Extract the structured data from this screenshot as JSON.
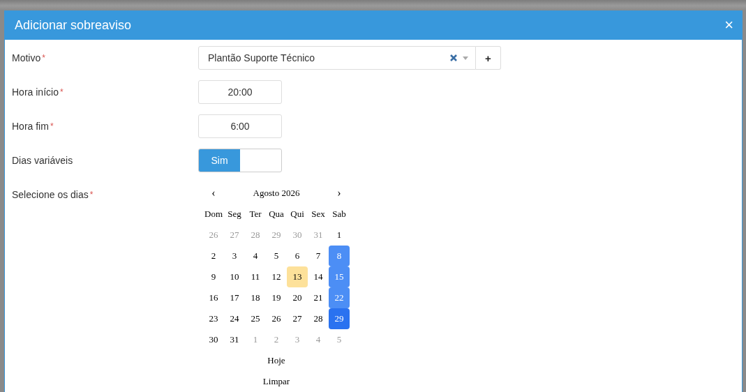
{
  "dialog": {
    "title": "Adicionar sobreaviso",
    "close": "×"
  },
  "fields": [
    {
      "kind": "select",
      "label": "Motivo",
      "required_mark": "*",
      "value": "Plantão Suporte Técnico",
      "add": "+"
    },
    {
      "kind": "time",
      "label": "Hora início",
      "required_mark": "*",
      "value": "20:00"
    },
    {
      "kind": "time",
      "label": "Hora fim",
      "required_mark": "*",
      "value": "6:00"
    },
    {
      "kind": "toggle",
      "label": "Dias variáveis",
      "value": "Sim",
      "on": true
    },
    {
      "kind": "calendar",
      "label": "Selecione os dias",
      "required_mark": "*"
    }
  ],
  "calendar": {
    "prev": "‹",
    "next": "›",
    "title": "Agosto 2026",
    "weekdays": [
      "Dom",
      "Seg",
      "Ter",
      "Qua",
      "Qui",
      "Sex",
      "Sab"
    ],
    "weeks": [
      [
        {
          "d": "26",
          "muted": true,
          "selected": false,
          "today": false,
          "focused": false
        },
        {
          "d": "27",
          "muted": true,
          "selected": false,
          "today": false,
          "focused": false
        },
        {
          "d": "28",
          "muted": true,
          "selected": false,
          "today": false,
          "focused": false
        },
        {
          "d": "29",
          "muted": true,
          "selected": false,
          "today": false,
          "focused": false
        },
        {
          "d": "30",
          "muted": true,
          "selected": false,
          "today": false,
          "focused": false
        },
        {
          "d": "31",
          "muted": true,
          "selected": false,
          "today": false,
          "focused": false
        },
        {
          "d": "1",
          "muted": false,
          "selected": false,
          "today": false,
          "focused": false
        }
      ],
      [
        {
          "d": "2",
          "muted": false,
          "selected": false,
          "today": false,
          "focused": false
        },
        {
          "d": "3",
          "muted": false,
          "selected": false,
          "today": false,
          "focused": false
        },
        {
          "d": "4",
          "muted": false,
          "selected": false,
          "today": false,
          "focused": false
        },
        {
          "d": "5",
          "muted": false,
          "selected": false,
          "today": false,
          "focused": false
        },
        {
          "d": "6",
          "muted": false,
          "selected": false,
          "today": false,
          "focused": false
        },
        {
          "d": "7",
          "muted": false,
          "selected": false,
          "today": false,
          "focused": false
        },
        {
          "d": "8",
          "muted": false,
          "selected": true,
          "today": false,
          "focused": false
        }
      ],
      [
        {
          "d": "9",
          "muted": false,
          "selected": false,
          "today": false,
          "focused": false
        },
        {
          "d": "10",
          "muted": false,
          "selected": false,
          "today": false,
          "focused": false
        },
        {
          "d": "11",
          "muted": false,
          "selected": false,
          "today": false,
          "focused": false
        },
        {
          "d": "12",
          "muted": false,
          "selected": false,
          "today": false,
          "focused": false
        },
        {
          "d": "13",
          "muted": false,
          "selected": false,
          "today": true,
          "focused": false
        },
        {
          "d": "14",
          "muted": false,
          "selected": false,
          "today": false,
          "focused": false
        },
        {
          "d": "15",
          "muted": false,
          "selected": true,
          "today": false,
          "focused": false
        }
      ],
      [
        {
          "d": "16",
          "muted": false,
          "selected": false,
          "today": false,
          "focused": false
        },
        {
          "d": "17",
          "muted": false,
          "selected": false,
          "today": false,
          "focused": false
        },
        {
          "d": "18",
          "muted": false,
          "selected": false,
          "today": false,
          "focused": false
        },
        {
          "d": "19",
          "muted": false,
          "selected": false,
          "today": false,
          "focused": false
        },
        {
          "d": "20",
          "muted": false,
          "selected": false,
          "today": false,
          "focused": false
        },
        {
          "d": "21",
          "muted": false,
          "selected": false,
          "today": false,
          "focused": false
        },
        {
          "d": "22",
          "muted": false,
          "selected": true,
          "today": false,
          "focused": false
        }
      ],
      [
        {
          "d": "23",
          "muted": false,
          "selected": false,
          "today": false,
          "focused": false
        },
        {
          "d": "24",
          "muted": false,
          "selected": false,
          "today": false,
          "focused": false
        },
        {
          "d": "25",
          "muted": false,
          "selected": false,
          "today": false,
          "focused": false
        },
        {
          "d": "26",
          "muted": false,
          "selected": false,
          "today": false,
          "focused": false
        },
        {
          "d": "27",
          "muted": false,
          "selected": false,
          "today": false,
          "focused": false
        },
        {
          "d": "28",
          "muted": false,
          "selected": false,
          "today": false,
          "focused": false
        },
        {
          "d": "29",
          "muted": false,
          "selected": true,
          "today": false,
          "focused": true
        }
      ],
      [
        {
          "d": "30",
          "muted": false,
          "selected": false,
          "today": false,
          "focused": false
        },
        {
          "d": "31",
          "muted": false,
          "selected": false,
          "today": false,
          "focused": false
        },
        {
          "d": "1",
          "muted": true,
          "selected": false,
          "today": false,
          "focused": false
        },
        {
          "d": "2",
          "muted": true,
          "selected": false,
          "today": false,
          "focused": false
        },
        {
          "d": "3",
          "muted": true,
          "selected": false,
          "today": false,
          "focused": false
        },
        {
          "d": "4",
          "muted": true,
          "selected": false,
          "today": false,
          "focused": false
        },
        {
          "d": "5",
          "muted": true,
          "selected": false,
          "today": false,
          "focused": false
        }
      ]
    ],
    "today_button": "Hoje",
    "clear_button": "Limpar"
  }
}
